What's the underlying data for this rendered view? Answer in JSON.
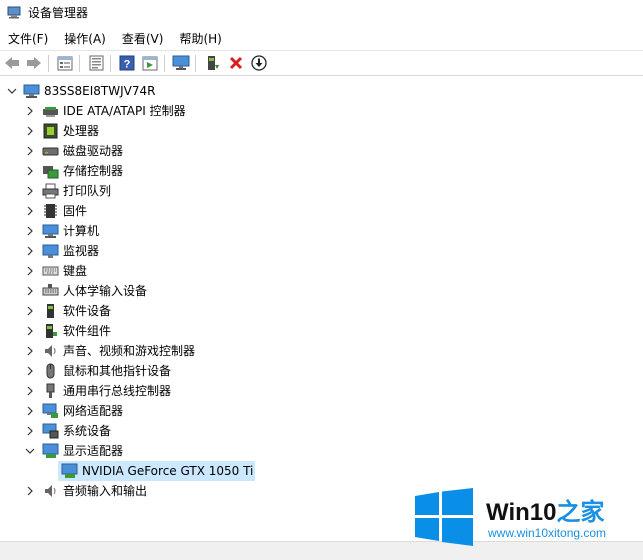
{
  "window": {
    "title": "设备管理器"
  },
  "menu": [
    "文件(F)",
    "操作(A)",
    "查看(V)",
    "帮助(H)"
  ],
  "toolbar": {
    "buttons": [
      "back-arrow-icon",
      "forward-arrow-icon",
      "properties-icon",
      "update-driver-icon",
      "help-icon",
      "scan-icon",
      "monitor-icon",
      "enable-device-icon",
      "uninstall-icon",
      "download-icon"
    ]
  },
  "tree": {
    "root": "83SS8EI8TWJV74R",
    "items": [
      {
        "label": "IDE ATA/ATAPI 控制器",
        "icon": "ide-controller-icon"
      },
      {
        "label": "处理器",
        "icon": "processor-icon"
      },
      {
        "label": "磁盘驱动器",
        "icon": "disk-drive-icon"
      },
      {
        "label": "存储控制器",
        "icon": "storage-controller-icon"
      },
      {
        "label": "打印队列",
        "icon": "printer-icon"
      },
      {
        "label": "固件",
        "icon": "firmware-icon"
      },
      {
        "label": "计算机",
        "icon": "computer-icon"
      },
      {
        "label": "监视器",
        "icon": "monitor-icon"
      },
      {
        "label": "键盘",
        "icon": "keyboard-icon"
      },
      {
        "label": "人体学输入设备",
        "icon": "hid-icon"
      },
      {
        "label": "软件设备",
        "icon": "software-device-icon"
      },
      {
        "label": "软件组件",
        "icon": "software-component-icon"
      },
      {
        "label": "声音、视频和游戏控制器",
        "icon": "sound-icon"
      },
      {
        "label": "鼠标和其他指针设备",
        "icon": "mouse-icon"
      },
      {
        "label": "通用串行总线控制器",
        "icon": "usb-icon"
      },
      {
        "label": "网络适配器",
        "icon": "network-adapter-icon"
      },
      {
        "label": "系统设备",
        "icon": "system-device-icon"
      },
      {
        "label": "显示适配器",
        "icon": "display-adapter-icon",
        "expanded": true,
        "children": [
          "NVIDIA GeForce GTX 1050 Ti"
        ]
      },
      {
        "label": "音频输入和输出",
        "icon": "audio-io-icon"
      }
    ]
  },
  "watermark": {
    "brand_main": "Win10",
    "brand_accent": "之家",
    "url": "www.win10xitong.com"
  },
  "colors": {
    "selection": "#cce8ff",
    "accent_blue": "#1a8fe3",
    "win_logo": "#0a8fe8"
  }
}
